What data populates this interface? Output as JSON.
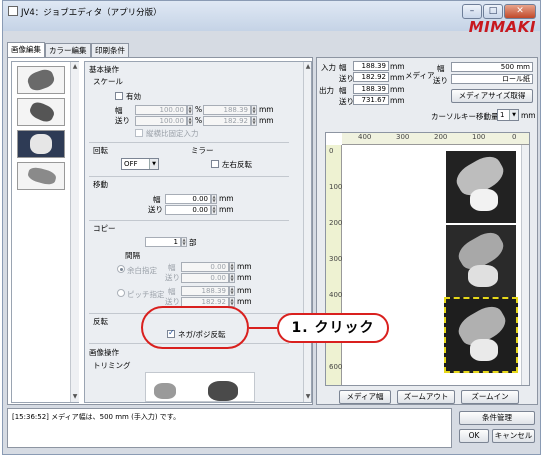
{
  "window": {
    "title": "JV4：ジョブエディタ（アプリ分版）",
    "logo": "MIMAKI",
    "minimize": "–",
    "maximize": "□",
    "close": "✕"
  },
  "tabs": [
    {
      "label": "画像編集"
    },
    {
      "label": "カラー編集"
    },
    {
      "label": "印刷条件"
    }
  ],
  "form": {
    "basic_ops": "基本操作",
    "scale": {
      "heading": "スケール",
      "enable_label": "有効",
      "width_label": "幅",
      "feed_label": "送り",
      "width_pct": "100.00",
      "feed_pct": "100.00",
      "width_mm": "188.39",
      "feed_mm": "182.92",
      "pct_unit": "%",
      "mm_unit": "mm",
      "lock_aspect_label": "縦横比固定入力"
    },
    "rotation": {
      "heading": "回転",
      "value": "OFF"
    },
    "mirror": {
      "heading": "ミラー",
      "label": "左右反転"
    },
    "move": {
      "heading": "移動",
      "width_label": "幅",
      "feed_label": "送り",
      "width_value": "0.00",
      "feed_value": "0.00",
      "unit": "mm"
    },
    "copy": {
      "heading": "コピー",
      "count": "1",
      "count_unit": "部",
      "spacing_heading": "間隔",
      "margin_label": "余白指定",
      "pitch_label": "ピッチ指定",
      "width_label": "幅",
      "feed_label": "送り",
      "margin_width": "0.00",
      "margin_feed": "0.00",
      "pitch_width": "188.39",
      "pitch_feed": "182.92",
      "unit": "mm"
    },
    "invert": {
      "heading": "反転",
      "label": "ネガ/ポジ反転",
      "checked": true
    },
    "image_ops": "画像操作",
    "trimming": "トリミング"
  },
  "right": {
    "input_label": "入力",
    "output_label": "出力",
    "width_label": "幅",
    "feed_label": "送り",
    "input_width": "188.39",
    "input_feed": "182.92",
    "output_width": "188.39",
    "output_feed": "731.67",
    "unit": "mm",
    "media_label": "メディア",
    "media_width_label": "幅",
    "media_feed_label": "送り",
    "media_width": "500 mm",
    "media_feed": "ロール紙",
    "media_size_button": "メディアサイズ取得",
    "cursor_key_label": "カーソルキー移動量",
    "cursor_key_value": "1",
    "cursor_key_unit": "mm",
    "ruler_top": [
      "400",
      "300",
      "200",
      "100",
      "0"
    ],
    "ruler_left": [
      "0",
      "100",
      "200",
      "300",
      "400",
      "500",
      "600"
    ],
    "media_width_button": "メディア幅",
    "zoom_out_button": "ズームアウト",
    "zoom_in_button": "ズームイン"
  },
  "status": {
    "message": "[15:36:52] メディア幅は、500 mm (手入力) です。"
  },
  "bottom_buttons": {
    "condition": "条件管理",
    "ok": "OK",
    "cancel": "キャンセル"
  },
  "callout": {
    "label": "1. クリック"
  }
}
